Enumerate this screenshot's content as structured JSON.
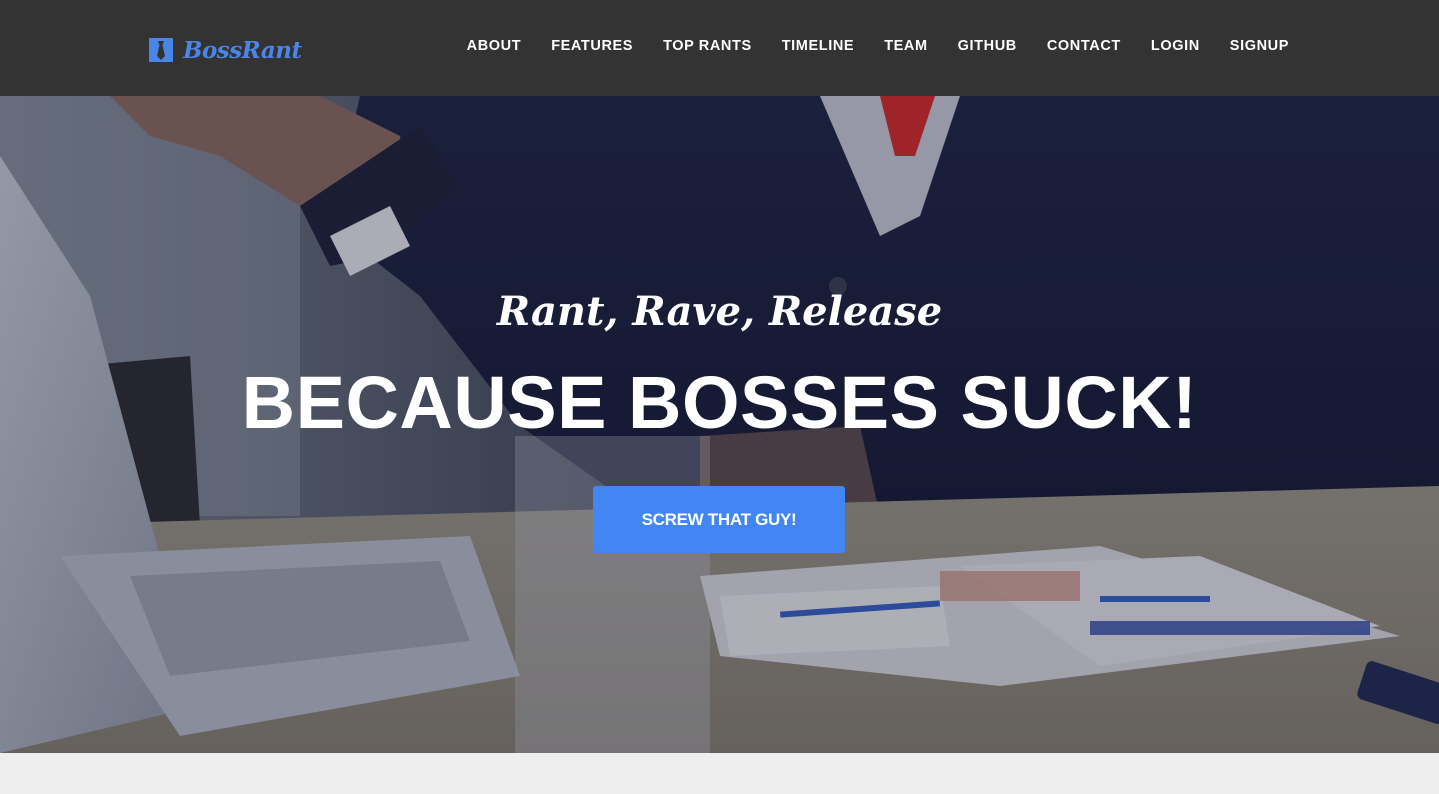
{
  "brand": {
    "name": "BossRant",
    "icon": "necktie-icon",
    "color": "#4a86e8"
  },
  "nav": {
    "items": [
      {
        "label": "ABOUT"
      },
      {
        "label": "FEATURES"
      },
      {
        "label": "TOP RANTS"
      },
      {
        "label": "TIMELINE"
      },
      {
        "label": "TEAM"
      },
      {
        "label": "GITHUB"
      },
      {
        "label": "CONTACT"
      },
      {
        "label": "LOGIN"
      },
      {
        "label": "SIGNUP"
      }
    ]
  },
  "hero": {
    "subtitle": "Rant, Rave, Release",
    "title": "BECAUSE BOSSES SUCK!",
    "button_label": "SCREW THAT GUY!",
    "button_color": "#4286f4"
  },
  "colors": {
    "navbar_bg": "#333333",
    "page_bg": "#eeeeee"
  }
}
